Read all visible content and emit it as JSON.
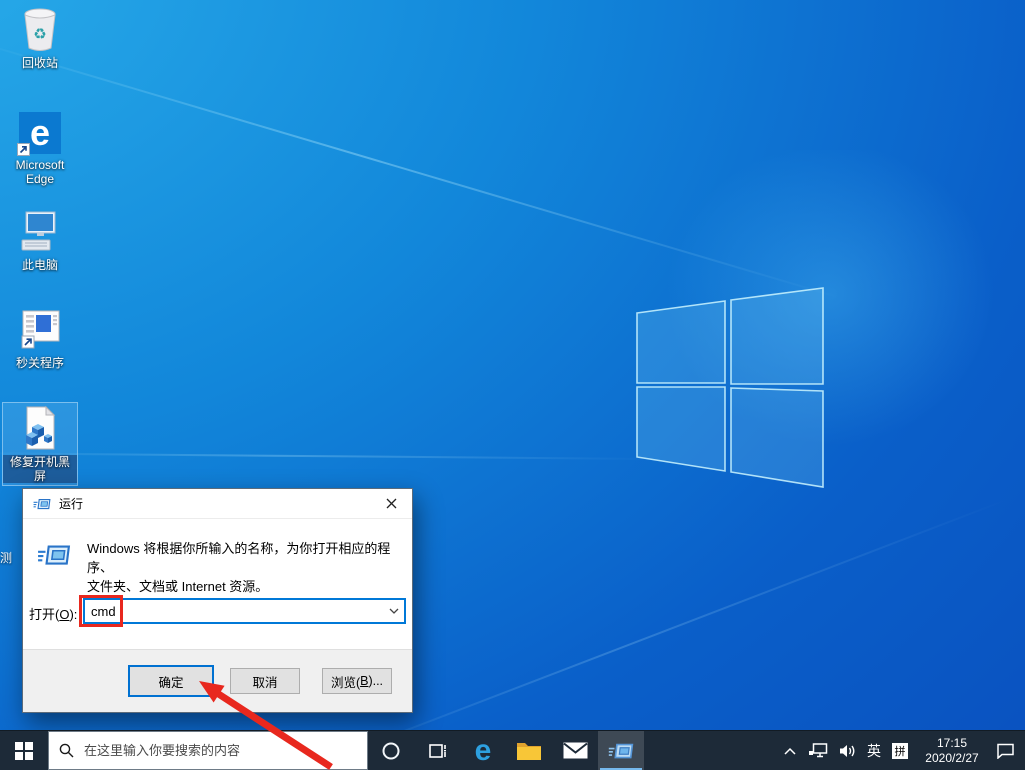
{
  "desktop_icons": [
    {
      "label": "回收站"
    },
    {
      "label": "Microsoft Edge"
    },
    {
      "label": "此电脑"
    },
    {
      "label": "秒关程序"
    },
    {
      "label": "修复开机黑屏"
    }
  ],
  "hidden_icon_partial_label": "测",
  "run_dialog": {
    "title": "运行",
    "message_line1": "Windows 将根据你所输入的名称，为你打开相应的程序、",
    "message_line2": "文件夹、文档或 Internet 资源。",
    "open_label": {
      "prefix": "打开(",
      "mnemonic": "O",
      "suffix": "):"
    },
    "input_value": "cmd",
    "buttons": {
      "ok": "确定",
      "cancel": "取消",
      "browse_prefix": "浏览(",
      "browse_mnemonic": "B",
      "browse_suffix": ")..."
    }
  },
  "taskbar": {
    "search_placeholder": "在这里输入你要搜索的内容",
    "tray": {
      "ime_language": "英",
      "ime_mode": "拼",
      "time": "17:15",
      "date": "2020/2/27"
    }
  },
  "colors": {
    "accent": "#0078d7",
    "taskbar_bg": "#1d2a38",
    "annotation_red": "#e8281e",
    "dialog_footer": "#f0f0f0"
  }
}
